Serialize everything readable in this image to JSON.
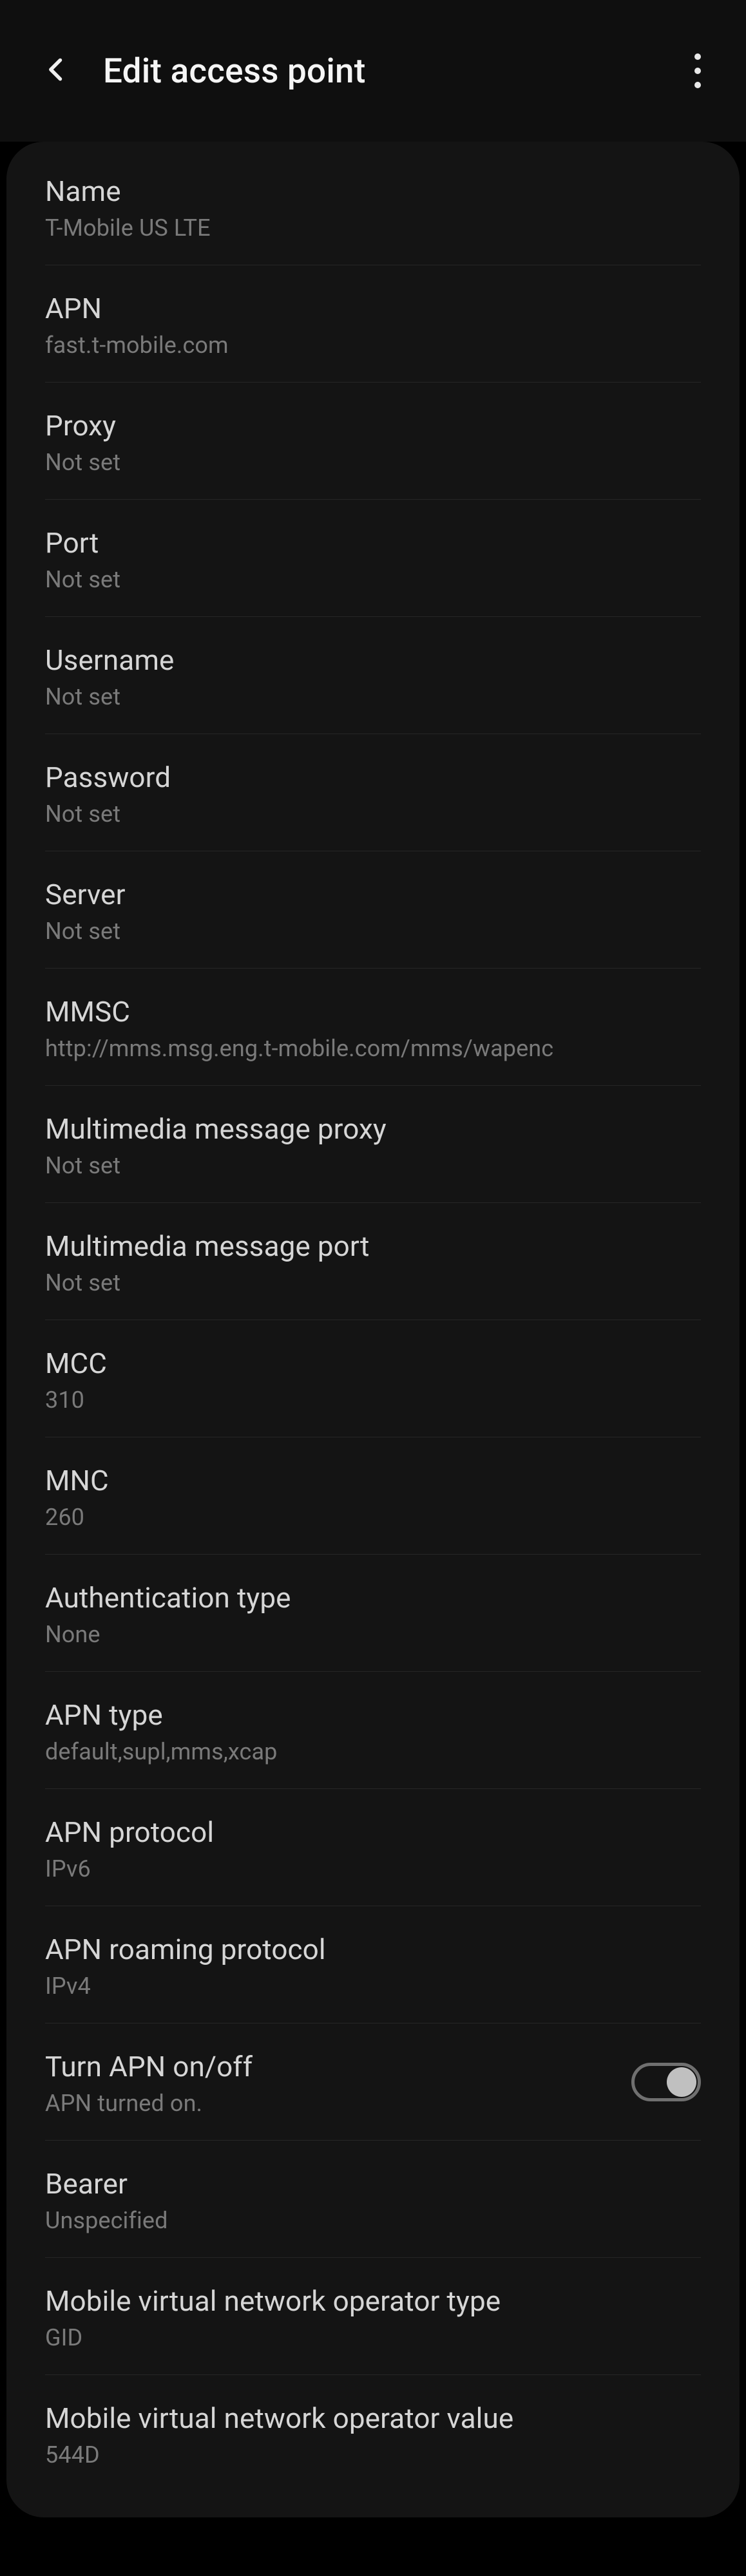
{
  "header": {
    "title": "Edit access point"
  },
  "rows": [
    {
      "label": "Name",
      "value": "T-Mobile US LTE"
    },
    {
      "label": "APN",
      "value": "fast.t-mobile.com"
    },
    {
      "label": "Proxy",
      "value": "Not set"
    },
    {
      "label": "Port",
      "value": "Not set"
    },
    {
      "label": "Username",
      "value": "Not set"
    },
    {
      "label": "Password",
      "value": "Not set"
    },
    {
      "label": "Server",
      "value": "Not set"
    },
    {
      "label": "MMSC",
      "value": "http://mms.msg.eng.t-mobile.com/mms/wapenc"
    },
    {
      "label": "Multimedia message proxy",
      "value": "Not set"
    },
    {
      "label": "Multimedia message port",
      "value": "Not set"
    },
    {
      "label": "MCC",
      "value": "310"
    },
    {
      "label": "MNC",
      "value": "260"
    },
    {
      "label": "Authentication type",
      "value": "None"
    },
    {
      "label": "APN type",
      "value": "default,supl,mms,xcap"
    },
    {
      "label": "APN protocol",
      "value": "IPv6"
    },
    {
      "label": "APN roaming protocol",
      "value": "IPv4"
    },
    {
      "label": "Turn APN on/off",
      "value": "APN turned on.",
      "toggle": true,
      "on": true
    },
    {
      "label": "Bearer",
      "value": "Unspecified"
    },
    {
      "label": "Mobile virtual network operator type",
      "value": "GID"
    },
    {
      "label": "Mobile virtual network operator value",
      "value": "544D"
    }
  ]
}
